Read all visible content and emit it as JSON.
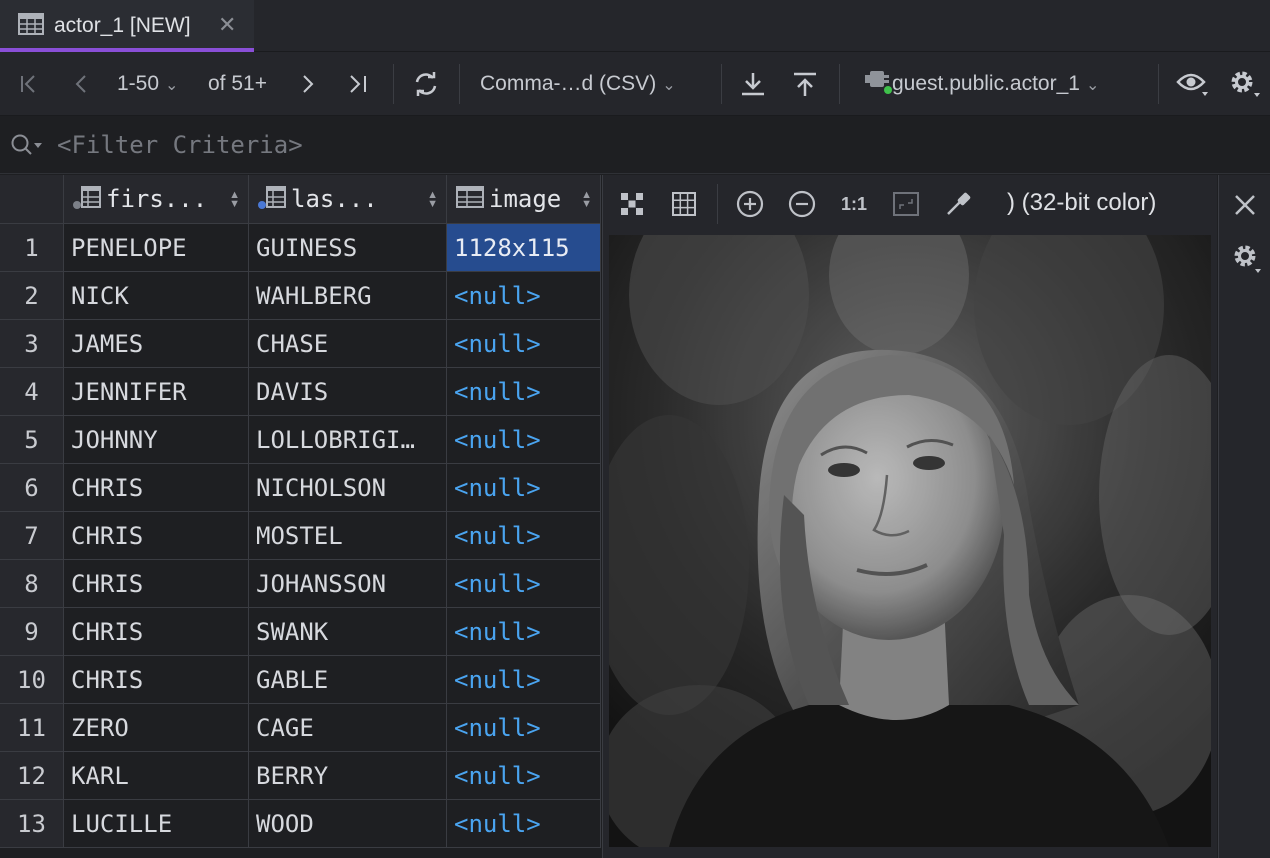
{
  "tab": {
    "title": "actor_1 [NEW]",
    "close_glyph": "✕"
  },
  "toolbar": {
    "range": "1-50",
    "of_count": "of 51+",
    "export_format": "Comma-…d (CSV)",
    "datasource": "guest.public.actor_1"
  },
  "filter": {
    "placeholder": "<Filter Criteria>"
  },
  "columns": [
    {
      "label": "firs..."
    },
    {
      "label": "las..."
    },
    {
      "label": "image"
    }
  ],
  "rows": [
    {
      "num": "1",
      "first": "PENELOPE",
      "last": "GUINESS",
      "image": "1128x115"
    },
    {
      "num": "2",
      "first": "NICK",
      "last": "WAHLBERG",
      "image": "<null>"
    },
    {
      "num": "3",
      "first": "JAMES",
      "last": "CHASE",
      "image": "<null>"
    },
    {
      "num": "4",
      "first": "JENNIFER",
      "last": "DAVIS",
      "image": "<null>"
    },
    {
      "num": "5",
      "first": "JOHNNY",
      "last": "LOLLOBRIGI…",
      "image": "<null>"
    },
    {
      "num": "6",
      "first": "CHRIS",
      "last": "NICHOLSON",
      "image": "<null>"
    },
    {
      "num": "7",
      "first": "CHRIS",
      "last": "MOSTEL",
      "image": "<null>"
    },
    {
      "num": "8",
      "first": "CHRIS",
      "last": "JOHANSSON",
      "image": "<null>"
    },
    {
      "num": "9",
      "first": "CHRIS",
      "last": "SWANK",
      "image": "<null>"
    },
    {
      "num": "10",
      "first": "CHRIS",
      "last": "GABLE",
      "image": "<null>"
    },
    {
      "num": "11",
      "first": "ZERO",
      "last": "CAGE",
      "image": "<null>"
    },
    {
      "num": "12",
      "first": "KARL",
      "last": "BERRY",
      "image": "<null>"
    },
    {
      "num": "13",
      "first": "LUCILLE",
      "last": "WOOD",
      "image": "<null>"
    }
  ],
  "viewer": {
    "zoom_actual": "1:1",
    "color_info": ") (32-bit color)"
  },
  "colors": {
    "accent_tab": "#8a4fd8",
    "null_text": "#4aa4f0",
    "selection": "#264c8f"
  }
}
